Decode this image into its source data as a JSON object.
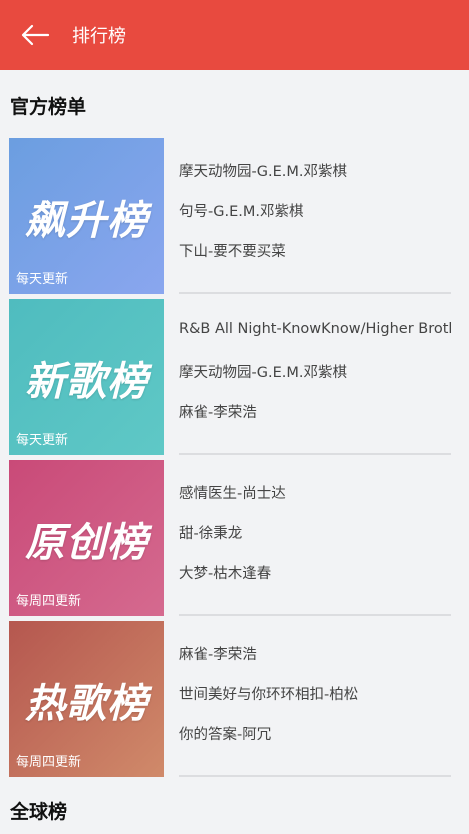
{
  "header": {
    "title": "排行榜"
  },
  "official": {
    "title": "官方榜单"
  },
  "global": {
    "title": "全球榜"
  },
  "charts": [
    {
      "cover_title": "飙升榜",
      "update": "每天更新",
      "colors": [
        "#6b9ee0",
        "#8aa6ef"
      ],
      "songs": [
        "摩天动物园-G.E.M.邓紫棋",
        "句号-G.E.M.邓紫棋",
        "下山-要不要买菜"
      ]
    },
    {
      "cover_title": "新歌榜",
      "update": "每天更新",
      "colors": [
        "#4fbcbf",
        "#5fc8c6"
      ],
      "songs": [
        "R&B All Night-KnowKnow/Higher Brothers",
        "摩天动物园-G.E.M.邓紫棋",
        "麻雀-李荣浩"
      ]
    },
    {
      "cover_title": "原创榜",
      "update": "每周四更新",
      "colors": [
        "#c94a78",
        "#d56a8f"
      ],
      "songs": [
        "感情医生-尚士达",
        "甜-徐秉龙",
        "大梦-枯木逢春"
      ]
    },
    {
      "cover_title": "热歌榜",
      "update": "每周四更新",
      "colors": [
        "#b5574f",
        "#d08a6a"
      ],
      "songs": [
        "麻雀-李荣浩",
        "世间美好与你环环相扣-柏松",
        "你的答案-阿冗"
      ]
    }
  ]
}
